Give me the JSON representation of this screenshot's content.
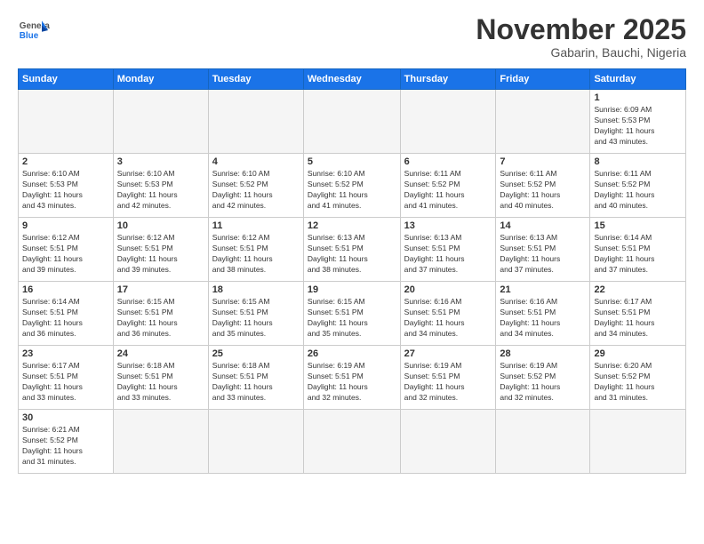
{
  "logo": {
    "text_general": "General",
    "text_blue": "Blue"
  },
  "header": {
    "month": "November 2025",
    "location": "Gabarin, Bauchi, Nigeria"
  },
  "weekdays": [
    "Sunday",
    "Monday",
    "Tuesday",
    "Wednesday",
    "Thursday",
    "Friday",
    "Saturday"
  ],
  "weeks": [
    [
      {
        "day": "",
        "info": ""
      },
      {
        "day": "",
        "info": ""
      },
      {
        "day": "",
        "info": ""
      },
      {
        "day": "",
        "info": ""
      },
      {
        "day": "",
        "info": ""
      },
      {
        "day": "",
        "info": ""
      },
      {
        "day": "1",
        "info": "Sunrise: 6:09 AM\nSunset: 5:53 PM\nDaylight: 11 hours\nand 43 minutes."
      }
    ],
    [
      {
        "day": "2",
        "info": "Sunrise: 6:10 AM\nSunset: 5:53 PM\nDaylight: 11 hours\nand 43 minutes."
      },
      {
        "day": "3",
        "info": "Sunrise: 6:10 AM\nSunset: 5:53 PM\nDaylight: 11 hours\nand 42 minutes."
      },
      {
        "day": "4",
        "info": "Sunrise: 6:10 AM\nSunset: 5:52 PM\nDaylight: 11 hours\nand 42 minutes."
      },
      {
        "day": "5",
        "info": "Sunrise: 6:10 AM\nSunset: 5:52 PM\nDaylight: 11 hours\nand 41 minutes."
      },
      {
        "day": "6",
        "info": "Sunrise: 6:11 AM\nSunset: 5:52 PM\nDaylight: 11 hours\nand 41 minutes."
      },
      {
        "day": "7",
        "info": "Sunrise: 6:11 AM\nSunset: 5:52 PM\nDaylight: 11 hours\nand 40 minutes."
      },
      {
        "day": "8",
        "info": "Sunrise: 6:11 AM\nSunset: 5:52 PM\nDaylight: 11 hours\nand 40 minutes."
      }
    ],
    [
      {
        "day": "9",
        "info": "Sunrise: 6:12 AM\nSunset: 5:51 PM\nDaylight: 11 hours\nand 39 minutes."
      },
      {
        "day": "10",
        "info": "Sunrise: 6:12 AM\nSunset: 5:51 PM\nDaylight: 11 hours\nand 39 minutes."
      },
      {
        "day": "11",
        "info": "Sunrise: 6:12 AM\nSunset: 5:51 PM\nDaylight: 11 hours\nand 38 minutes."
      },
      {
        "day": "12",
        "info": "Sunrise: 6:13 AM\nSunset: 5:51 PM\nDaylight: 11 hours\nand 38 minutes."
      },
      {
        "day": "13",
        "info": "Sunrise: 6:13 AM\nSunset: 5:51 PM\nDaylight: 11 hours\nand 37 minutes."
      },
      {
        "day": "14",
        "info": "Sunrise: 6:13 AM\nSunset: 5:51 PM\nDaylight: 11 hours\nand 37 minutes."
      },
      {
        "day": "15",
        "info": "Sunrise: 6:14 AM\nSunset: 5:51 PM\nDaylight: 11 hours\nand 37 minutes."
      }
    ],
    [
      {
        "day": "16",
        "info": "Sunrise: 6:14 AM\nSunset: 5:51 PM\nDaylight: 11 hours\nand 36 minutes."
      },
      {
        "day": "17",
        "info": "Sunrise: 6:15 AM\nSunset: 5:51 PM\nDaylight: 11 hours\nand 36 minutes."
      },
      {
        "day": "18",
        "info": "Sunrise: 6:15 AM\nSunset: 5:51 PM\nDaylight: 11 hours\nand 35 minutes."
      },
      {
        "day": "19",
        "info": "Sunrise: 6:15 AM\nSunset: 5:51 PM\nDaylight: 11 hours\nand 35 minutes."
      },
      {
        "day": "20",
        "info": "Sunrise: 6:16 AM\nSunset: 5:51 PM\nDaylight: 11 hours\nand 34 minutes."
      },
      {
        "day": "21",
        "info": "Sunrise: 6:16 AM\nSunset: 5:51 PM\nDaylight: 11 hours\nand 34 minutes."
      },
      {
        "day": "22",
        "info": "Sunrise: 6:17 AM\nSunset: 5:51 PM\nDaylight: 11 hours\nand 34 minutes."
      }
    ],
    [
      {
        "day": "23",
        "info": "Sunrise: 6:17 AM\nSunset: 5:51 PM\nDaylight: 11 hours\nand 33 minutes."
      },
      {
        "day": "24",
        "info": "Sunrise: 6:18 AM\nSunset: 5:51 PM\nDaylight: 11 hours\nand 33 minutes."
      },
      {
        "day": "25",
        "info": "Sunrise: 6:18 AM\nSunset: 5:51 PM\nDaylight: 11 hours\nand 33 minutes."
      },
      {
        "day": "26",
        "info": "Sunrise: 6:19 AM\nSunset: 5:51 PM\nDaylight: 11 hours\nand 32 minutes."
      },
      {
        "day": "27",
        "info": "Sunrise: 6:19 AM\nSunset: 5:51 PM\nDaylight: 11 hours\nand 32 minutes."
      },
      {
        "day": "28",
        "info": "Sunrise: 6:19 AM\nSunset: 5:52 PM\nDaylight: 11 hours\nand 32 minutes."
      },
      {
        "day": "29",
        "info": "Sunrise: 6:20 AM\nSunset: 5:52 PM\nDaylight: 11 hours\nand 31 minutes."
      }
    ],
    [
      {
        "day": "30",
        "info": "Sunrise: 6:21 AM\nSunset: 5:52 PM\nDaylight: 11 hours\nand 31 minutes."
      },
      {
        "day": "",
        "info": ""
      },
      {
        "day": "",
        "info": ""
      },
      {
        "day": "",
        "info": ""
      },
      {
        "day": "",
        "info": ""
      },
      {
        "day": "",
        "info": ""
      },
      {
        "day": "",
        "info": ""
      }
    ]
  ]
}
